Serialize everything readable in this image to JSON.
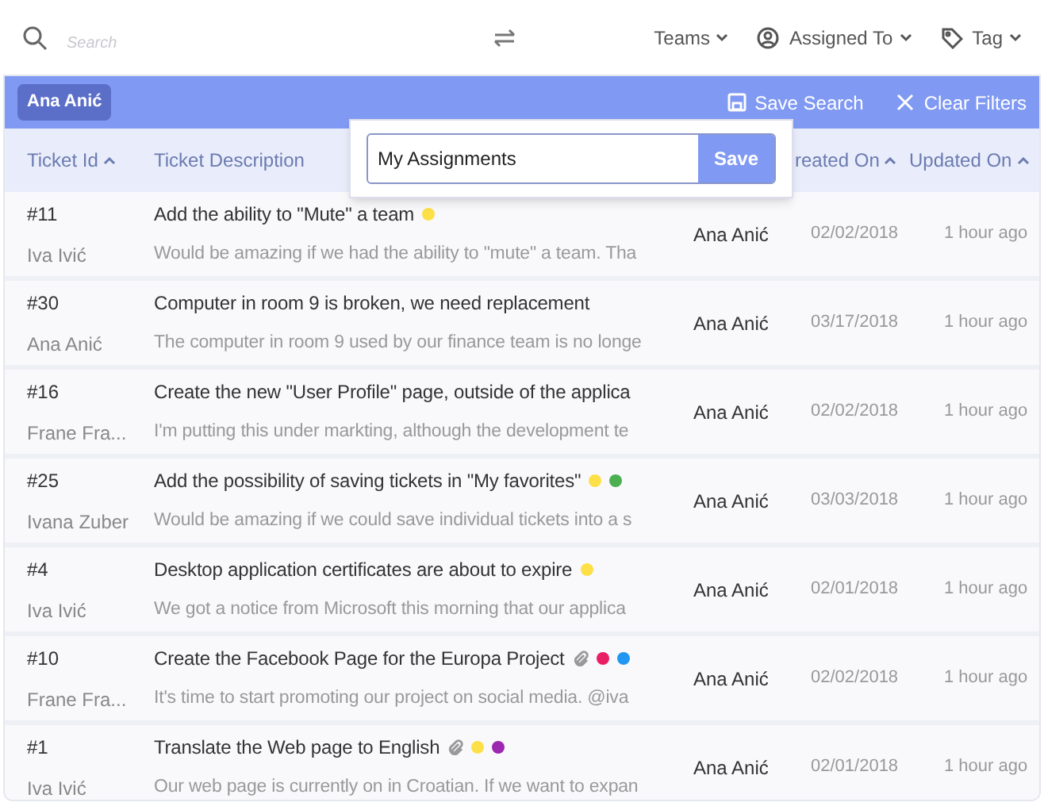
{
  "toolbar": {
    "search": {
      "placeholder": "Search"
    },
    "filters": [
      {
        "label": "Teams",
        "kind": "plain"
      },
      {
        "label": "Assigned To",
        "kind": "person"
      },
      {
        "label": "Tag",
        "kind": "tag"
      }
    ]
  },
  "filter_bar": {
    "chips": [
      "Ana Anić"
    ],
    "actions": [
      {
        "label": "Save Search",
        "kind": "save"
      },
      {
        "label": "Clear Filters",
        "kind": "clear"
      }
    ]
  },
  "save_popover": {
    "value": "My Assignments",
    "button": "Save"
  },
  "table": {
    "columns": [
      {
        "label": "Ticket Id",
        "sortable": true
      },
      {
        "label": "Ticket Description",
        "sortable": false
      },
      {
        "label": "reated On",
        "sortable": true
      },
      {
        "label": "Updated On",
        "sortable": true
      }
    ],
    "rows": [
      {
        "id": "#11",
        "reporter": "Iva Ivić",
        "title": "Add the ability to \"Mute\" a team",
        "attachment": false,
        "tags": [
          {
            "color": "#fde047"
          }
        ],
        "description": "Would be amazing if we had the ability to \"mute\" a team. Tha",
        "assignee": "Ana Anić",
        "created": "02/02/2018",
        "updated": "1 hour ago"
      },
      {
        "id": "#30",
        "reporter": "Ana Anić",
        "title": "Computer in room 9 is broken, we need replacement",
        "attachment": false,
        "tags": [],
        "description": "The computer in room 9 used by our finance team is no longe",
        "assignee": "Ana Anić",
        "created": "03/17/2018",
        "updated": "1 hour ago"
      },
      {
        "id": "#16",
        "reporter": "Frane Fra...",
        "title": "Create the new \"User Profile\" page, outside of the applica",
        "attachment": false,
        "tags": [],
        "description": "I'm putting this under markting, although the development te",
        "assignee": "Ana Anić",
        "created": "02/02/2018",
        "updated": "1 hour ago"
      },
      {
        "id": "#25",
        "reporter": "Ivana Zuber",
        "title": "Add the possibility of saving tickets in \"My favorites\"",
        "attachment": false,
        "tags": [
          {
            "color": "#fde047"
          },
          {
            "color": "#4caf50"
          }
        ],
        "description": "Would be amazing if we could save individual tickets into a s",
        "assignee": "Ana Anić",
        "created": "03/03/2018",
        "updated": "1 hour ago"
      },
      {
        "id": "#4",
        "reporter": "Iva Ivić",
        "title": "Desktop application certificates are about to expire",
        "attachment": false,
        "tags": [
          {
            "color": "#fde047"
          }
        ],
        "description": "We got a notice from Microsoft this morning that our applica",
        "assignee": "Ana Anić",
        "created": "02/01/2018",
        "updated": "1 hour ago"
      },
      {
        "id": "#10",
        "reporter": "Frane Fra...",
        "title": "Create the Facebook Page for the Europa Project",
        "attachment": true,
        "tags": [
          {
            "color": "#e91e63"
          },
          {
            "color": "#2196f3"
          }
        ],
        "description": "It's time to start promoting our project on social media. @iva",
        "assignee": "Ana Anić",
        "created": "02/02/2018",
        "updated": "1 hour ago"
      },
      {
        "id": "#1",
        "reporter": "Iva Ivić",
        "title": "Translate the Web page to English",
        "attachment": true,
        "tags": [
          {
            "color": "#fde047"
          },
          {
            "color": "#9c27b0"
          }
        ],
        "description": "Our web page is currently on in Croatian. If we want to expan",
        "assignee": "Ana Anić",
        "created": "02/01/2018",
        "updated": "1 hour ago"
      }
    ]
  }
}
